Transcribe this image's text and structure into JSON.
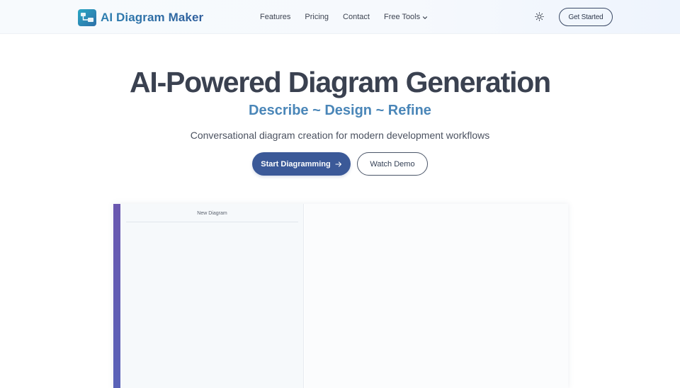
{
  "header": {
    "logo_text": "AI Diagram Maker",
    "nav": [
      {
        "label": "Features"
      },
      {
        "label": "Pricing"
      },
      {
        "label": "Contact"
      },
      {
        "label": "Free Tools"
      }
    ],
    "theme_icon": "sun-icon",
    "cta_label": "Get Started"
  },
  "hero": {
    "title": "AI-Powered Diagram Generation",
    "subtitle": "Describe ~ Design ~ Refine",
    "description": "Conversational diagram creation for modern development workflows",
    "primary_button": "Start Diagramming",
    "primary_icon": "arrow-right-icon",
    "secondary_button": "Watch Demo"
  },
  "preview": {
    "sidebar_title": "New Diagram"
  },
  "colors": {
    "brand": "#3b5998",
    "accent": "#4a86b8",
    "heading": "#3a4150",
    "preview_bar": "#6a58b0"
  }
}
